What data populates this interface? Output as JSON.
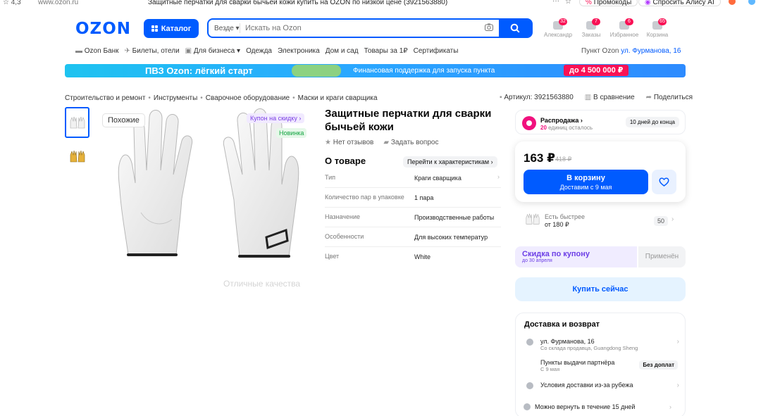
{
  "browser": {
    "rating": "4,3",
    "url": "www.ozon.ru",
    "page_title": "Защитные перчатки для сварки бычьей кожи купить на OZON по низкой цене (3921563880)",
    "more": "···",
    "promo_label": "Промокоды",
    "alice_label": "Спросить Алису AI"
  },
  "header": {
    "logo": "OZON",
    "catalog_label": "Каталог",
    "search_scope": "Везде",
    "search_placeholder": "Искать на Ozon",
    "icons": [
      {
        "label": "Александр",
        "badge": "32",
        "icon": "profile-icon"
      },
      {
        "label": "Заказы",
        "badge": "7",
        "icon": "orders-icon"
      },
      {
        "label": "Избранное",
        "badge": "6",
        "icon": "heart-icon"
      },
      {
        "label": "Корзина",
        "badge": "65",
        "icon": "cart-icon"
      }
    ]
  },
  "nav": {
    "items": [
      "Ozon Банк",
      "Билеты, отели",
      "Для бизнеса",
      "Одежда",
      "Электроника",
      "Дом и сад",
      "Товары за 1₽",
      "Сертификаты"
    ],
    "pickup_label": "Пункт Ozon",
    "pickup_address": "ул. Фурманова, 16"
  },
  "banner": {
    "title": "ПВЗ Ozon: лёгкий старт",
    "subtitle": "Финансовая поддержка для запуска пункта",
    "amount": "до 4 500 000 ₽"
  },
  "breadcrumbs": [
    "Строительство и ремонт",
    "Инструменты",
    "Сварочное оборудование",
    "Маски и краги сварщика"
  ],
  "meta": {
    "article": "Артикул: 3921563880",
    "compare": "В сравнение",
    "share": "Поделиться"
  },
  "gallery": {
    "similar_label": "Похожие",
    "coupon_label": "Купон на скидку",
    "new_label": "Новинка",
    "caption": "Отличные качества"
  },
  "product": {
    "title": "Защитные перчатки для сварки бычьей кожи",
    "reviews": "Нет отзывов",
    "ask": "Задать вопрос",
    "about_title": "О товаре",
    "specs_link": "Перейти к характеристикам",
    "specs": [
      {
        "k": "Тип",
        "v": "Краги сварщика"
      },
      {
        "k": "Количество пар в упаковке",
        "v": "1 пара"
      },
      {
        "k": "Назначение",
        "v": "Производственные работы"
      },
      {
        "k": "Особенности",
        "v": "Для высоких температур"
      },
      {
        "k": "Цвет",
        "v": "White"
      }
    ]
  },
  "sale": {
    "title": "Распродажа",
    "units_count": "20",
    "units_left": "единиц осталось",
    "days": "10 дней до конца"
  },
  "price": {
    "current": "163 ₽",
    "old": "418 ₽",
    "cart_label": "В корзину",
    "cart_delivery": "Доставим с 9 мая"
  },
  "faster": {
    "label": "Есть быстрее",
    "price": "от 180 ₽",
    "qty": "50"
  },
  "coupon": {
    "title": "Скидка по купону",
    "until": "до 30 апреля",
    "apply": "Применён"
  },
  "buy_now": "Купить сейчас",
  "delivery": {
    "title": "Доставка и возврат",
    "rows": [
      {
        "t1": "ул. Фурманова, 16",
        "t2": "Со склада продавца, Guangdong Sheng"
      },
      {
        "t1": "Пункты выдачи партнёра",
        "t2": "С 9 мая",
        "tag": "Без доплат"
      },
      {
        "t1": "Условия доставки из-за рубежа"
      }
    ],
    "return": "Можно вернуть в течение 15 дней"
  },
  "colors": {
    "brand": "#005bff",
    "accent": "#f91155",
    "coupon": "#6c3ee6"
  }
}
